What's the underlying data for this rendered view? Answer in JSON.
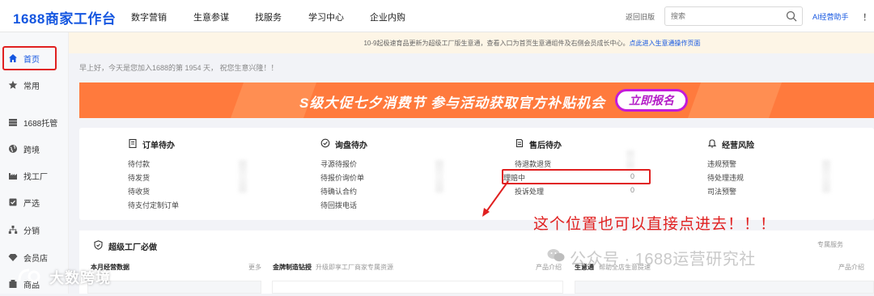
{
  "brand": {
    "number": "1688",
    "name": "商家工作台"
  },
  "nav": [
    "数字营销",
    "生意参谋",
    "找服务",
    "学习中心",
    "企业内购"
  ],
  "header": {
    "back_old": "返回旧版",
    "search_placeholder": "搜索",
    "ai_helper": "AI经营助手",
    "notice_cut": "！"
  },
  "sidebar": {
    "items": [
      {
        "label": "首页",
        "icon": "home-icon"
      },
      {
        "label": "常用",
        "icon": "star-icon"
      },
      {
        "label": "1688托管",
        "icon": "stack-icon"
      },
      {
        "label": "跨境",
        "icon": "globe-icon"
      },
      {
        "label": "找工厂",
        "icon": "factory-icon"
      },
      {
        "label": "严选",
        "icon": "badge-icon"
      },
      {
        "label": "分销",
        "icon": "network-icon"
      },
      {
        "label": "会员店",
        "icon": "gem-icon"
      },
      {
        "label": "商品",
        "icon": "box-icon"
      }
    ]
  },
  "notice": {
    "text": "10-9起极速育品更新为超级工厂版生意通，查看入口为首页生意通组件及右侧会员成长中心。",
    "link": "点此进入生意通操作页面"
  },
  "greeting": "早上好，今天是您加入1688的第 1954 天， 祝您生意兴隆！！",
  "banner": {
    "text": "S级大促七夕消费节  参与活动获取官方补贴机会",
    "button": "立即报名"
  },
  "todo": {
    "columns": [
      {
        "title": "订单待办",
        "icon": "clipboard-icon",
        "rows": [
          "待付款",
          "待发货",
          "待收货",
          "待支付定制订单"
        ]
      },
      {
        "title": "询盘待办",
        "icon": "check-circle-icon",
        "rows": [
          "寻源待报价",
          "待报价询价单",
          "待确认合约",
          "待回拨电话"
        ]
      },
      {
        "title": "售后待办",
        "icon": "document-icon",
        "rows": [
          "待退款退货",
          "理赔中",
          "投诉处理"
        ],
        "values": [
          "",
          "0",
          "0"
        ]
      },
      {
        "title": "经营风险",
        "icon": "bell-icon",
        "rows": [
          "违规预警",
          "待处理违规",
          "司法预警"
        ]
      }
    ]
  },
  "annotation": "这个位置也可以直接点进去！！！",
  "section2": {
    "title": "超级工厂必做",
    "monthly": "本月经营数据",
    "more": "更多",
    "gold": "金牌制造钻授",
    "gold_desc": "升级即享工厂商家专属资源",
    "product_intro": "产品介绍",
    "biz_label": "生意通",
    "biz_desc": "帮助全店生意提速",
    "product_intro2": "产品介绍",
    "service": "专属服务"
  },
  "watermark": {
    "right": "公众号 · 1688运营研究社",
    "left": "大数跨境"
  }
}
